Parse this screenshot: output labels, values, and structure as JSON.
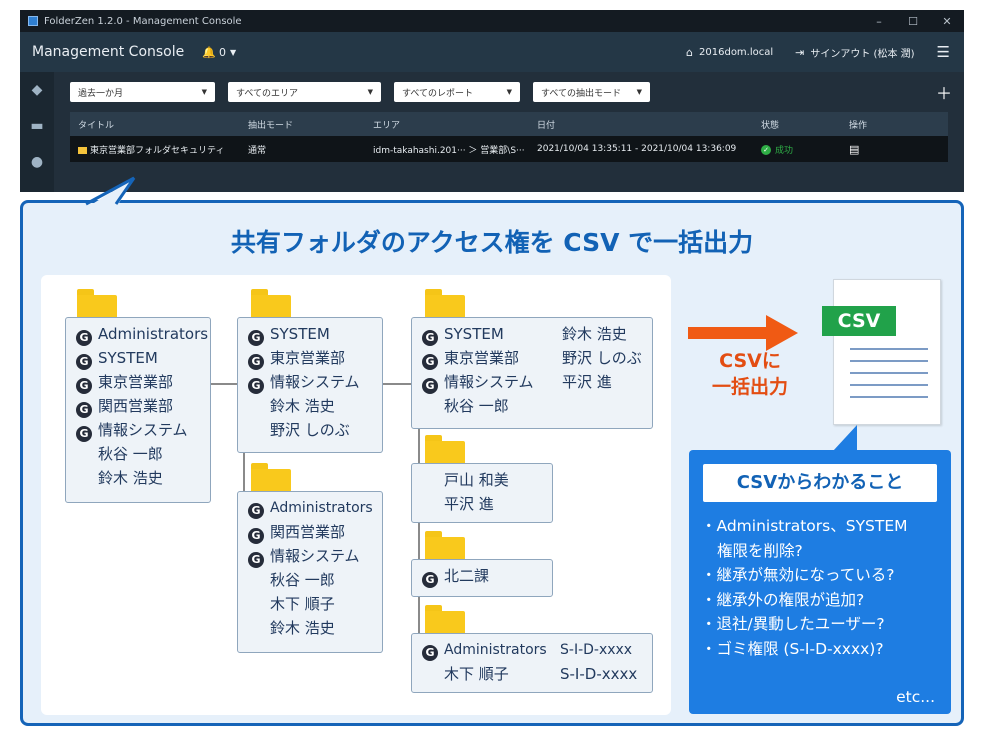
{
  "window": {
    "title": "FolderZen 1.2.0 - Management Console",
    "controls": [
      "–",
      "☐",
      "✕"
    ]
  },
  "topbar": {
    "title": "Management Console",
    "notif_count": "0",
    "domain": "2016dom.local",
    "signout": "サインアウト (松本 潤)"
  },
  "filters": [
    {
      "label": "過去一か月"
    },
    {
      "label": "すべてのエリア"
    },
    {
      "label": "すべてのレポート"
    },
    {
      "label": "すべての抽出モード"
    }
  ],
  "grid": {
    "headers": [
      "タイトル",
      "抽出モード",
      "エリア",
      "日付",
      "状態",
      "操作"
    ],
    "row": {
      "title": "東京営業部フォルダセキュリティ",
      "mode": "通常",
      "area": "idm-takahashi.201··· ＞ 営業部\\S···",
      "date": "2021/10/04 13:35:11 - 2021/10/04 13:36:09",
      "status": "成功"
    }
  },
  "panel": {
    "title": "共有フォルダのアクセス権を CSV で一括出力"
  },
  "tree": {
    "box1": [
      "Administrators",
      "SYSTEM",
      "東京営業部",
      "関西営業部",
      "情報システム"
    ],
    "box1_users": [
      "秋谷 一郎",
      "鈴木 浩史"
    ],
    "box2": [
      "SYSTEM",
      "東京営業部",
      "情報システム"
    ],
    "box2_users": [
      "鈴木 浩史",
      "野沢 しのぶ"
    ],
    "box3": [
      "Administrators",
      "関西営業部",
      "情報システム"
    ],
    "box3_users": [
      "秋谷 一郎",
      "木下 順子",
      "鈴木 浩史"
    ],
    "box4": [
      "SYSTEM",
      "東京営業部",
      "情報システム"
    ],
    "box4_right": [
      "鈴木 浩史",
      "野沢 しのぶ",
      "平沢 進"
    ],
    "box4_users": [
      "秋谷 一郎"
    ],
    "box5_users": [
      "戸山 和美",
      "平沢 進"
    ],
    "box6": [
      "北二課"
    ],
    "box7": [
      "Administrators"
    ],
    "box7_right": [
      "S-I-D-xxxx",
      "S-I-D-xxxx"
    ],
    "box7_users": [
      "木下 順子"
    ],
    "group_badge": "G"
  },
  "csv": {
    "badge": "CSV",
    "arrow_label_1": "CSVに",
    "arrow_label_2": "一括出力",
    "arrow_color": "#f05a14"
  },
  "info": {
    "title": "CSVからわかること",
    "items": [
      "・Administrators、SYSTEM",
      "権限を削除?",
      "・継承が無効になっている?",
      "・継承外の権限が追加?",
      "・退社/異動したユーザー?",
      "・ゴミ権限 (S-I-D-xxxx)?"
    ],
    "etc": "etc..."
  }
}
